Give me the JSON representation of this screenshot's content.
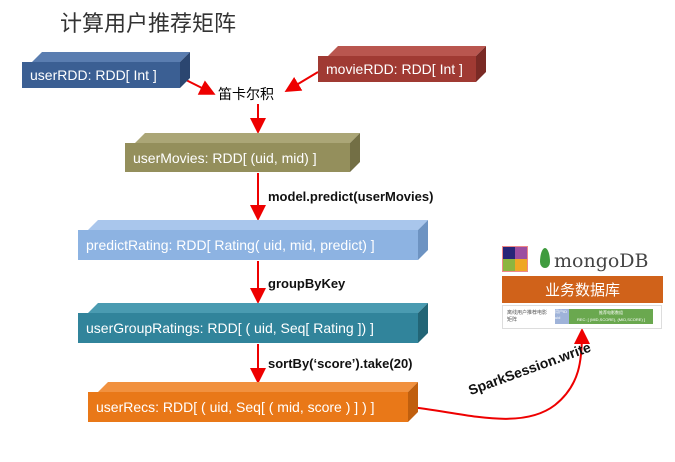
{
  "title": "计算用户推荐矩阵",
  "boxes": {
    "user_rdd": "userRDD: RDD[ Int ]",
    "movie_rdd": "movieRDD: RDD[ Int ]",
    "user_movies": "userMovies: RDD[ (uid, mid) ]",
    "predict_rating": "predictRating: RDD[ Rating( uid, mid, predict) ]",
    "user_group_ratings": "userGroupRatings: RDD[ ( uid, Seq[ Rating ]) ]",
    "user_recs": "userRecs: RDD[ ( uid, Seq[ ( mid, score ) ] ) ]"
  },
  "edges": {
    "cartesian": "笛卡尔积",
    "predict": "model.predict(userMovies)",
    "group": "groupByKey",
    "sort": "sortBy(‘score’).take(20)",
    "write": "SparkSession.write"
  },
  "database": {
    "logo": "mongoDB",
    "title": "业务数据库",
    "table_label": "离线用户推荐电影矩阵",
    "col1": "用户ID uid",
    "col2_title": "推荐电影数组",
    "col2_value": "REC: [ (MID,SCORE), (MID,SCORE) ]"
  }
}
